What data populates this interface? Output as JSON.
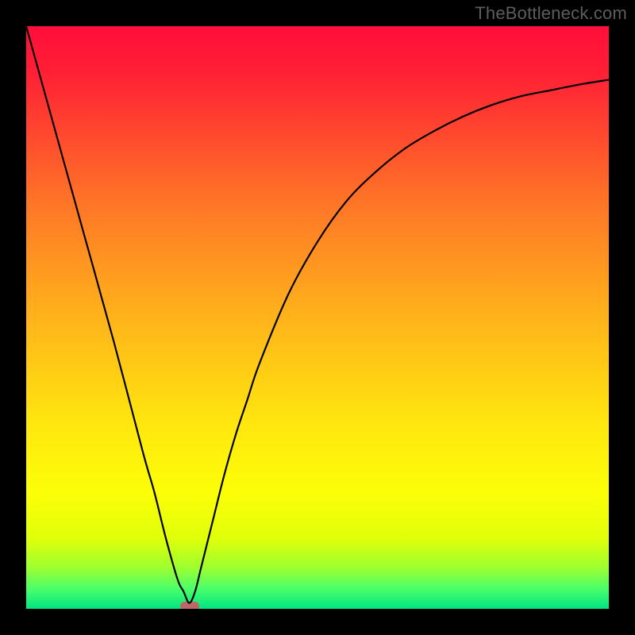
{
  "watermark": "TheBottleneck.com",
  "chart_data": {
    "type": "line",
    "title": "",
    "xlabel": "",
    "ylabel": "",
    "xlim": [
      0,
      100
    ],
    "ylim": [
      0,
      100
    ],
    "series": [
      {
        "name": "bottleneck-curve",
        "x": [
          0,
          5,
          10,
          15,
          20,
          22,
          24,
          26,
          27,
          28,
          29,
          30,
          32,
          34,
          36,
          38,
          40,
          45,
          50,
          55,
          60,
          65,
          70,
          75,
          80,
          85,
          90,
          95,
          100
        ],
        "values": [
          100,
          82,
          64,
          46,
          27,
          20,
          12,
          5,
          3,
          1,
          3,
          7,
          15,
          23,
          30,
          36,
          42,
          54,
          63,
          70,
          75,
          79,
          82,
          84.5,
          86.5,
          88,
          89,
          90,
          90.8
        ]
      }
    ],
    "minimum": {
      "x": 28,
      "y": 0
    },
    "gradient_stops": [
      {
        "offset": 0.0,
        "color": "#ff0e3a"
      },
      {
        "offset": 0.08,
        "color": "#ff2035"
      },
      {
        "offset": 0.3,
        "color": "#ff7427"
      },
      {
        "offset": 0.5,
        "color": "#ffb31b"
      },
      {
        "offset": 0.68,
        "color": "#ffe60f"
      },
      {
        "offset": 0.8,
        "color": "#fcff08"
      },
      {
        "offset": 0.88,
        "color": "#e0ff0a"
      },
      {
        "offset": 0.93,
        "color": "#9cff30"
      },
      {
        "offset": 0.965,
        "color": "#4cff6a"
      },
      {
        "offset": 1.0,
        "color": "#00e582"
      }
    ]
  }
}
